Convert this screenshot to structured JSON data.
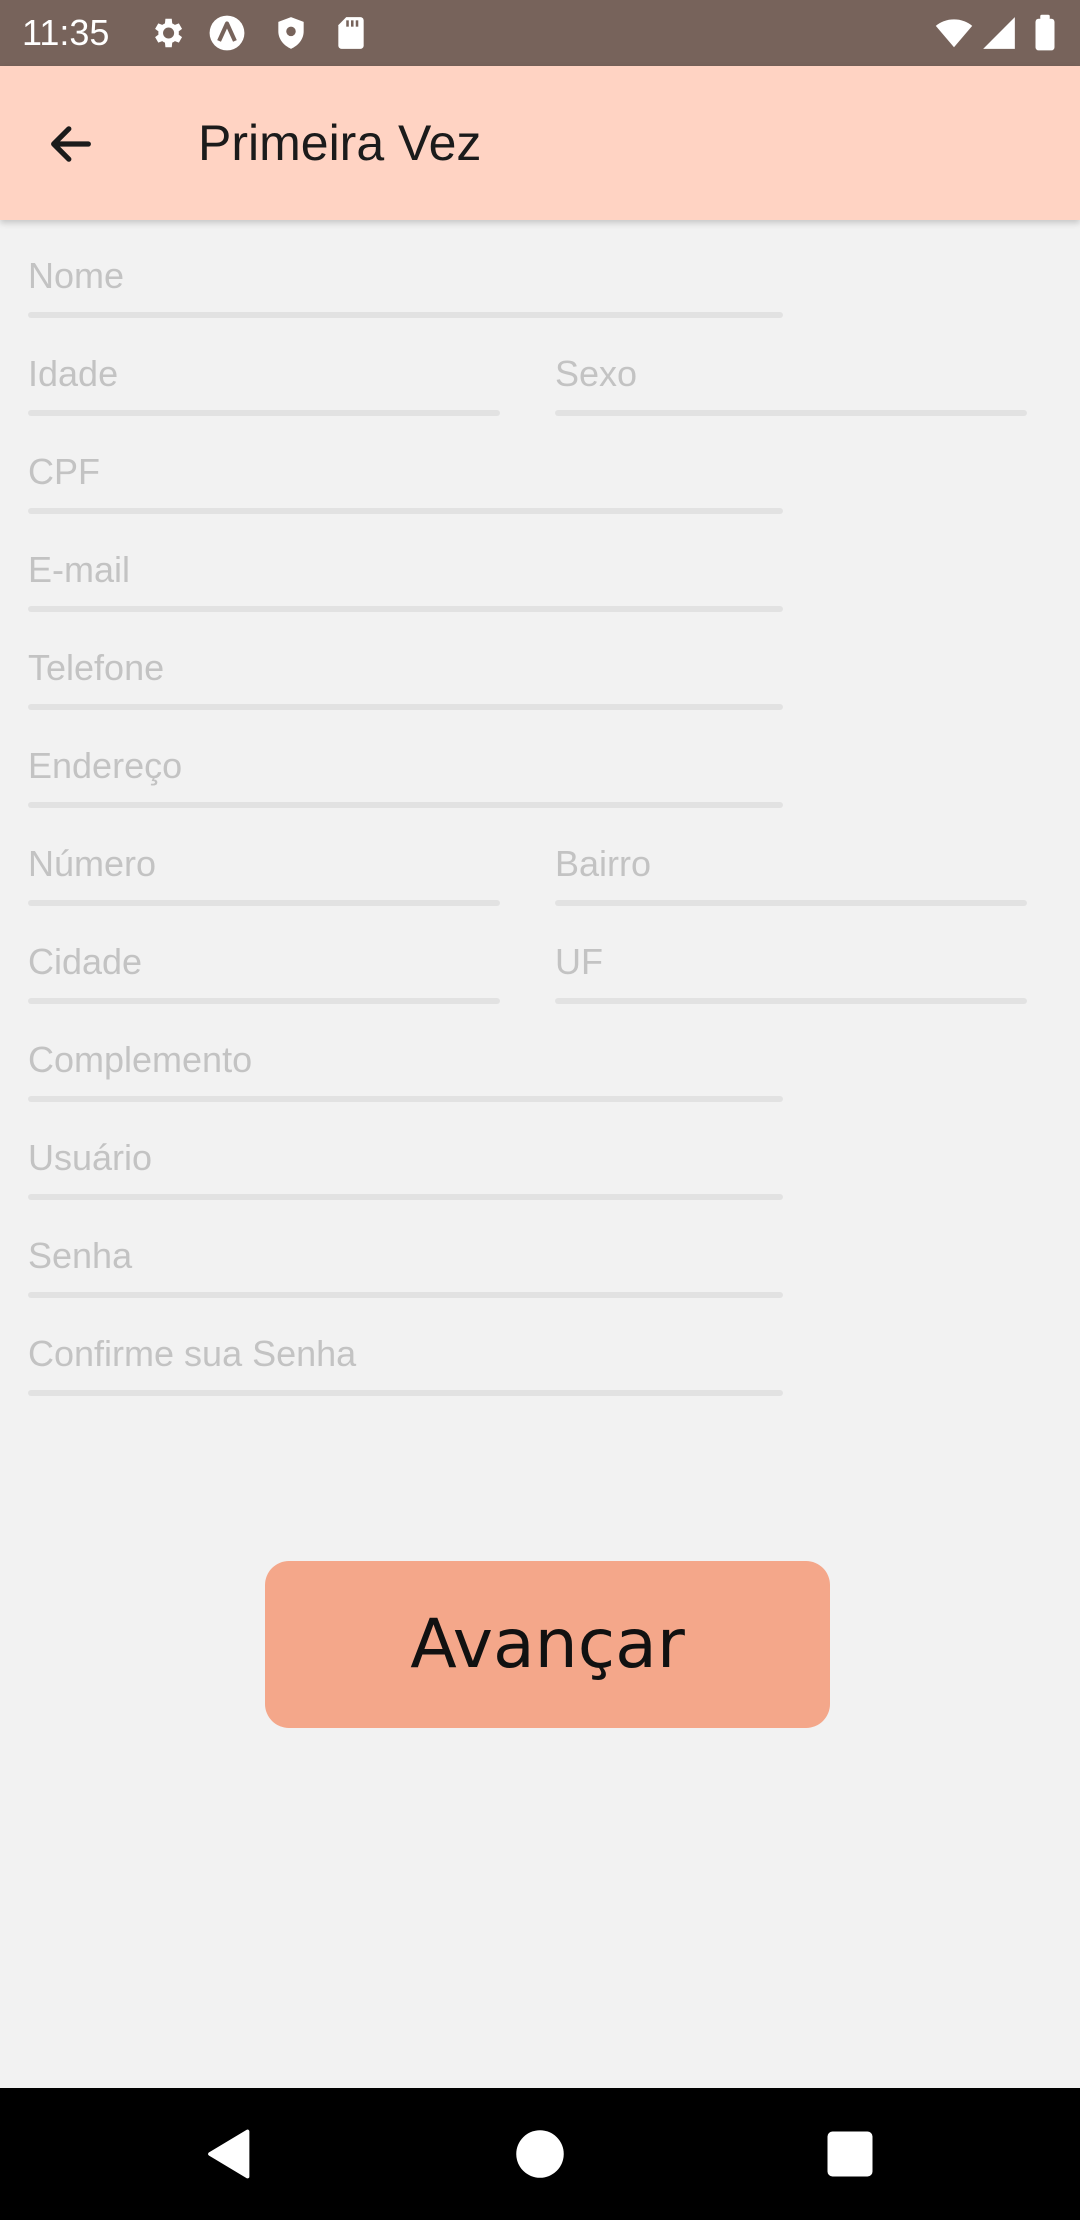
{
  "status_bar": {
    "time": "11:35",
    "left_icons": [
      "settings-icon",
      "app-a-icon",
      "shield-icon",
      "sd-card-icon"
    ],
    "right_icons": [
      "wifi-icon",
      "signal-icon",
      "battery-icon"
    ]
  },
  "app_bar": {
    "title": "Primeira Vez",
    "back_icon": "arrow-back-icon"
  },
  "form": {
    "nome": {
      "placeholder": "Nome",
      "value": ""
    },
    "idade": {
      "placeholder": "Idade",
      "value": ""
    },
    "sexo": {
      "placeholder": "Sexo",
      "value": ""
    },
    "cpf": {
      "placeholder": "CPF",
      "value": ""
    },
    "email": {
      "placeholder": "E-mail",
      "value": ""
    },
    "telefone": {
      "placeholder": "Telefone",
      "value": ""
    },
    "endereco": {
      "placeholder": "Endereço",
      "value": ""
    },
    "numero": {
      "placeholder": "Número",
      "value": ""
    },
    "bairro": {
      "placeholder": "Bairro",
      "value": ""
    },
    "cidade": {
      "placeholder": "Cidade",
      "value": ""
    },
    "uf": {
      "placeholder": "UF",
      "value": ""
    },
    "complemento": {
      "placeholder": "Complemento",
      "value": ""
    },
    "usuario": {
      "placeholder": "Usuário",
      "value": ""
    },
    "senha": {
      "placeholder": "Senha",
      "value": ""
    },
    "confirme_senha": {
      "placeholder": "Confirme sua Senha",
      "value": ""
    }
  },
  "actions": {
    "advance_label": "Avançar"
  },
  "colors": {
    "status_bar": "#77635b",
    "app_bar": "#ffd3c3",
    "background": "#f2f2f2",
    "button": "#f4a78a",
    "placeholder": "#c3c3c3",
    "underline": "#e2e2e2"
  },
  "nav_bar": {
    "icons": [
      "back-triangle-icon",
      "home-circle-icon",
      "recents-square-icon"
    ]
  }
}
